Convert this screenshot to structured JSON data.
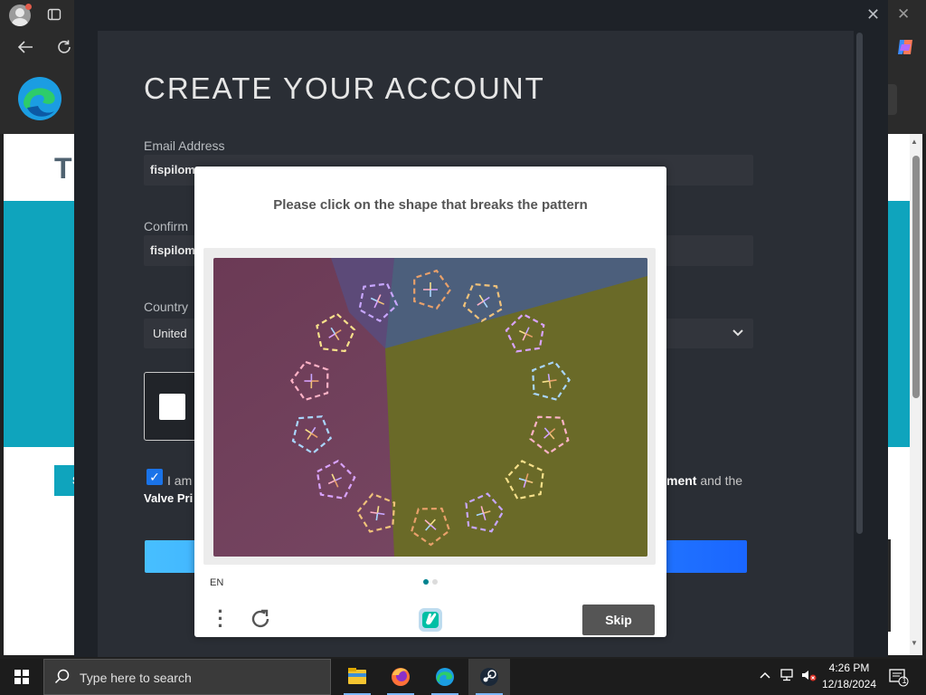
{
  "steam": {
    "title": "CREATE YOUR ACCOUNT",
    "email_label": "Email Address",
    "email_value": "fispilom",
    "confirm_label": "Confirm",
    "confirm_value": "fispilom",
    "country_label": "Country",
    "country_value": "United",
    "agree_prefix": "I am",
    "agree_suffix_bold": "ment",
    "agree_suffix": " and the",
    "valve_link": "Valve Pri"
  },
  "captcha": {
    "prompt": "Please click on the shape that breaks the pattern",
    "language": "EN",
    "skip_label": "Skip",
    "page_dots": 2,
    "active_page": 1
  },
  "background_page": {
    "letter": "T",
    "tab_letter": "S"
  },
  "taskbar": {
    "search_placeholder": "Type here to search",
    "apps": [
      "file-explorer",
      "firefox",
      "edge",
      "steam"
    ],
    "active_app": "steam",
    "time": "4:26 PM",
    "date": "12/18/2024",
    "notification_count": "1"
  },
  "colors": {
    "accent_blue": "#1a73e8",
    "captcha_teal": "#00838f",
    "steam_bg": "#2a2e35",
    "button_gradient_start": "#47bfff",
    "button_gradient_end": "#1a66ff"
  }
}
